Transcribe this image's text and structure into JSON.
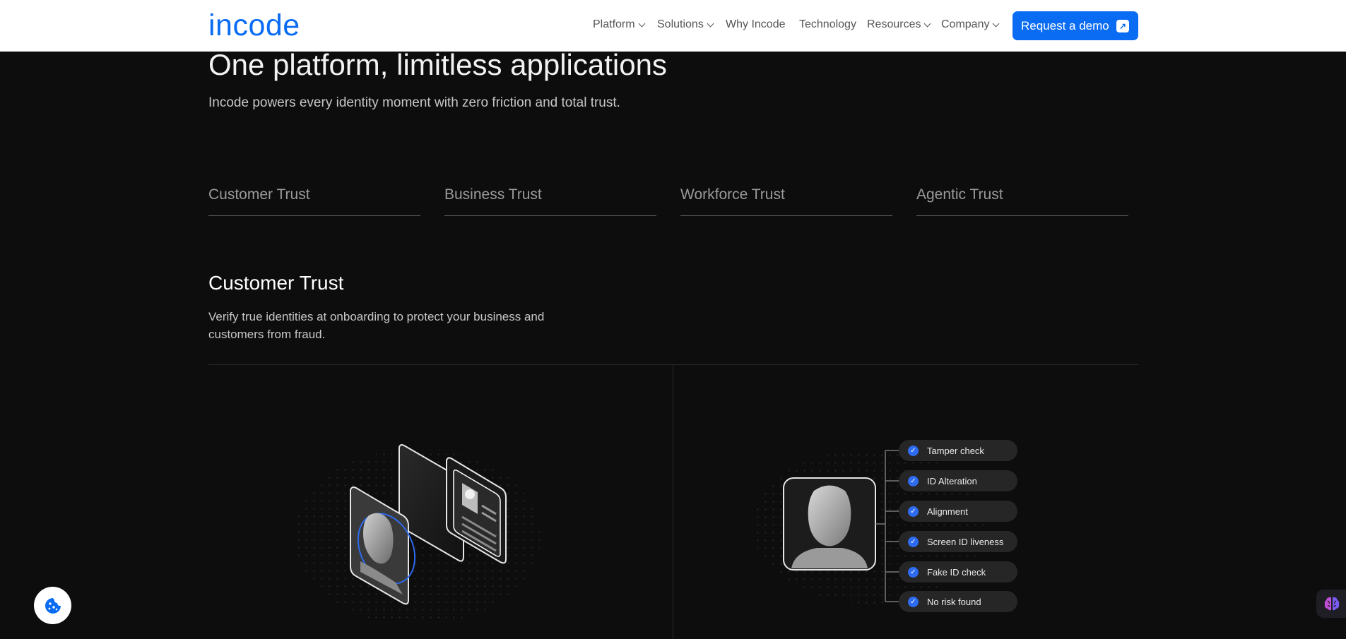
{
  "header": {
    "logo": "incode",
    "nav": [
      {
        "label": "Platform",
        "dropdown": true
      },
      {
        "label": "Solutions",
        "dropdown": true
      },
      {
        "label": "Why Incode",
        "dropdown": false
      },
      {
        "label": "Technology",
        "dropdown": false
      },
      {
        "label": "Resources",
        "dropdown": true
      },
      {
        "label": "Company",
        "dropdown": true
      }
    ],
    "cta_label": "Request a demo"
  },
  "hero": {
    "title": "One platform, limitless applications",
    "subtitle": "Incode powers every identity moment with zero friction and total trust."
  },
  "tabs": [
    "Customer Trust",
    "Business Trust",
    "Workforce Trust",
    "Agentic Trust"
  ],
  "section": {
    "title": "Customer Trust",
    "description": "Verify true identities at onboarding to protect your business and customers from fraud."
  },
  "checks": [
    "Tamper check",
    "ID Alteration",
    "Alignment",
    "Screen ID liveness",
    "Fake ID check",
    "No risk found"
  ],
  "colors": {
    "accent": "#0a6cf3",
    "background": "#0d0d0d",
    "check_pill": "#262626",
    "check_icon": "#2e6bf0"
  },
  "icons": {
    "cta": "arrow-up-right-icon",
    "cookie": "cookie-icon",
    "assistant": "brain-icon",
    "check": "check-icon"
  }
}
